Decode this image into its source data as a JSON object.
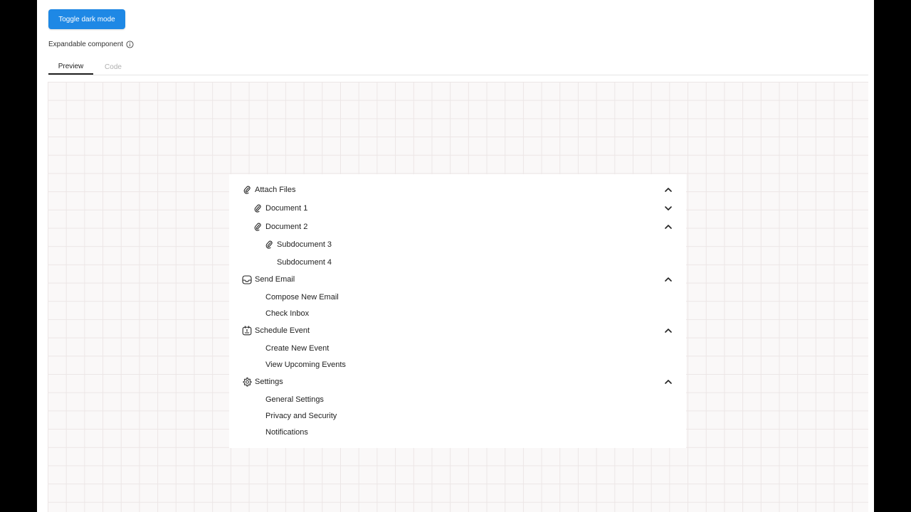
{
  "toolbar": {
    "toggle_label": "Toggle dark mode"
  },
  "component": {
    "label": "Expandable component"
  },
  "tabs": [
    {
      "label": "Preview",
      "active": true
    },
    {
      "label": "Code",
      "active": false
    }
  ],
  "tree": {
    "attach_files": {
      "label": "Attach Files",
      "icon": "paperclip-icon",
      "expanded": true
    },
    "document_1": {
      "label": "Document 1",
      "icon": "paperclip-icon",
      "expanded": false
    },
    "document_2": {
      "label": "Document 2",
      "icon": "paperclip-icon",
      "expanded": true
    },
    "subdocument_3": {
      "label": "Subdocument 3",
      "icon": "paperclip-icon"
    },
    "subdocument_4": {
      "label": "Subdocument 4"
    },
    "send_email": {
      "label": "Send Email",
      "icon": "inbox-icon",
      "expanded": true
    },
    "compose_new_email": {
      "label": "Compose New Email"
    },
    "check_inbox": {
      "label": "Check Inbox"
    },
    "schedule_event": {
      "label": "Schedule Event",
      "icon": "calendar-icon",
      "expanded": true
    },
    "create_new_event": {
      "label": "Create New Event"
    },
    "view_upcoming_events": {
      "label": "View Upcoming Events"
    },
    "settings": {
      "label": "Settings",
      "icon": "gear-icon",
      "expanded": true
    },
    "general_settings": {
      "label": "General Settings"
    },
    "privacy_and_security": {
      "label": "Privacy and Security"
    },
    "notifications": {
      "label": "Notifications"
    }
  },
  "colors": {
    "accent": "#1e88e5",
    "text": "#222222",
    "muted_tab": "#b0b0b0",
    "canvas_bg": "#faf8f8",
    "grid_line": "#ece6e6"
  }
}
